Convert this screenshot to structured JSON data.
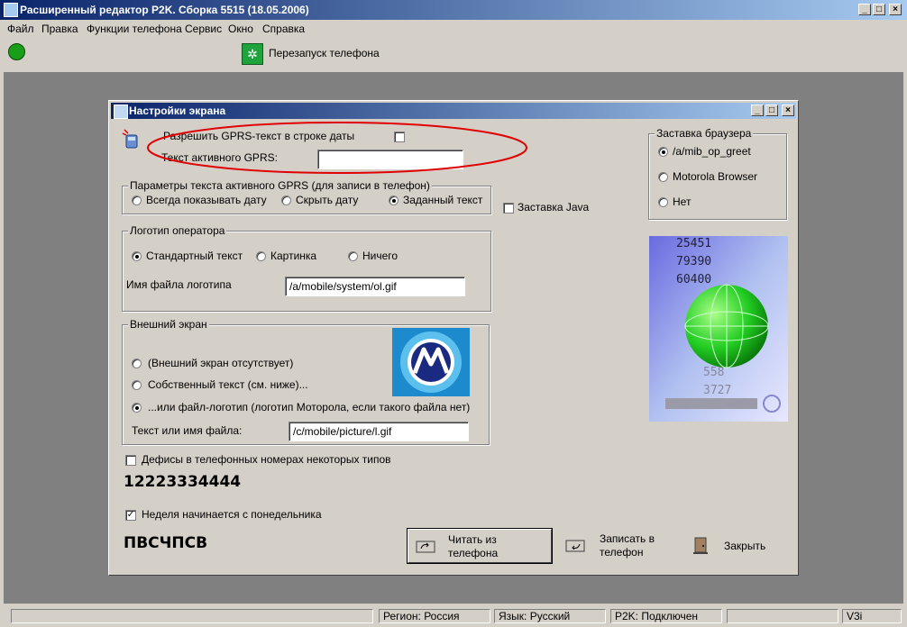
{
  "window": {
    "title": "Расширенный редактор P2K. Сборка 5515 (18.05.2006)",
    "caption_min": "_",
    "caption_max": "□",
    "caption_close": "×"
  },
  "menu": [
    "Файл",
    "Правка",
    "Функции телефона",
    "Сервис",
    "Окно",
    "Справка"
  ],
  "toolbar": {
    "restart_label": "Перезапуск телефона"
  },
  "dialog": {
    "title": "Настройки экрана",
    "gprs": {
      "allow_label": "Разрешить GPRS-текст в строке даты",
      "active_text_label": "Текст активного GPRS:",
      "active_text_value": ""
    },
    "gprs_params": {
      "legend": "Параметры текста активного GPRS (для записи в телефон)",
      "options": [
        "Всегда показывать дату",
        "Скрыть дату",
        "Заданный текст"
      ],
      "selected": 2
    },
    "java_saver_label": "Заставка Java",
    "browser_saver": {
      "legend": "Заставка браузера",
      "options": [
        "/a/mib_op_greet",
        "Motorola Browser",
        "Нет"
      ],
      "selected": 0
    },
    "preview_digits": [
      "25451",
      "79390",
      "60400",
      "558",
      "3727"
    ],
    "operator_logo": {
      "legend": "Логотип оператора",
      "options": [
        "Стандартный текст",
        "Картинка",
        "Ничего"
      ],
      "selected": 0,
      "filename_label": "Имя файла логотипа",
      "filename_value": "/a/mobile/system/ol.gif"
    },
    "external_screen": {
      "legend": "Внешний экран",
      "options": [
        "(Внешний экран отсутствует)",
        "Собственный текст (см. ниже)...",
        "...или файл-логотип (логотип Моторола, если такого файла нет)"
      ],
      "selected": 2,
      "text_label": "Текст или имя файла:",
      "text_value": "/c/mobile/picture/l.gif"
    },
    "hyphens_label": "Дефисы в телефонных номерах некоторых типов",
    "hyphens_example": "12223334444",
    "week_monday_label": "Неделя начинается с понедельника",
    "week_example": "ПВСЧПСВ",
    "buttons": {
      "read": "Читать из телефона",
      "write": "Записать в телефон",
      "close": "Закрыть"
    }
  },
  "status": {
    "region": "Регион: Россия",
    "language": "Язык: Русский",
    "connection": "P2K: Подключен",
    "model": "V3i"
  },
  "colors": {
    "title_from": "#0a246a",
    "title_to": "#a6caf0",
    "accent_red": "#e00000",
    "status_green": "#1a9e1a"
  }
}
